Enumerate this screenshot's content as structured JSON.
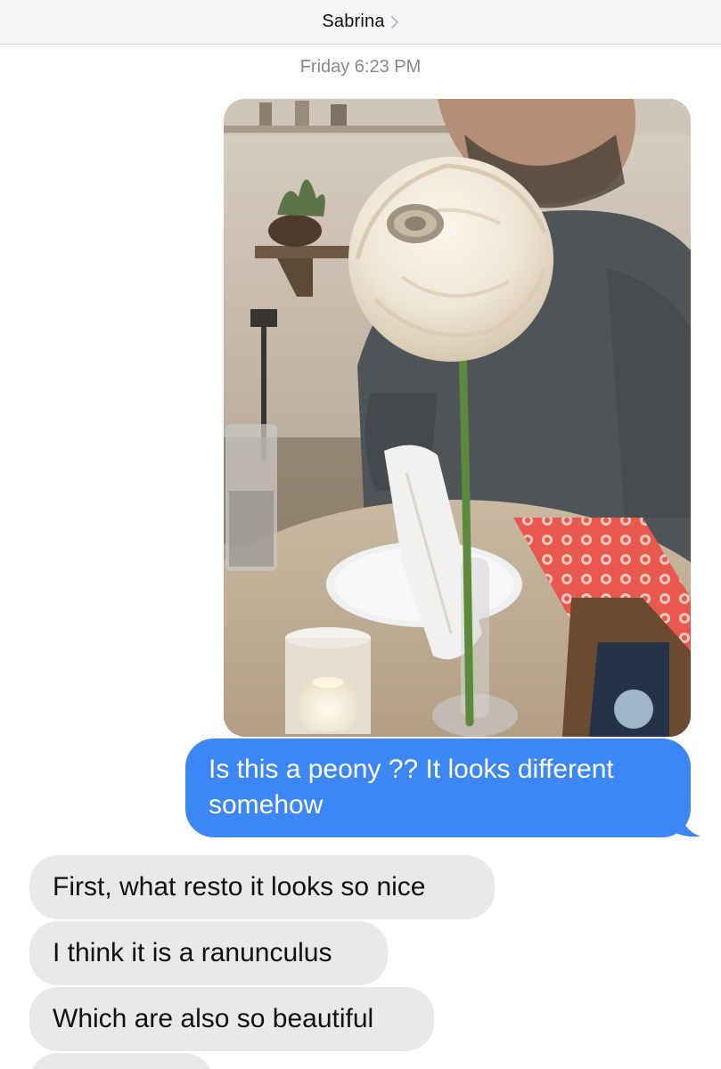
{
  "header": {
    "contact_name": "Sabrina",
    "chevron_icon": "chevron-right-icon"
  },
  "thread": {
    "timestamp": "Friday 6:23 PM",
    "photo": {
      "subject": "white ranunculus flower in bud vase on restaurant table"
    },
    "messages": [
      {
        "direction": "sent",
        "text": "Is this a peony ?? It looks different somehow"
      },
      {
        "direction": "received",
        "text": "First, what resto it looks so nice"
      },
      {
        "direction": "received",
        "text": "I think it is a ranunculus"
      },
      {
        "direction": "received",
        "text": "Which are also so beautiful"
      },
      {
        "direction": "received",
        "text": ""
      }
    ]
  },
  "colors": {
    "sent_bubble": "#3d86f5",
    "received_bubble": "#e9e9eb",
    "header_bg": "#f6f6f8",
    "timestamp_text": "#8a8a8e"
  }
}
